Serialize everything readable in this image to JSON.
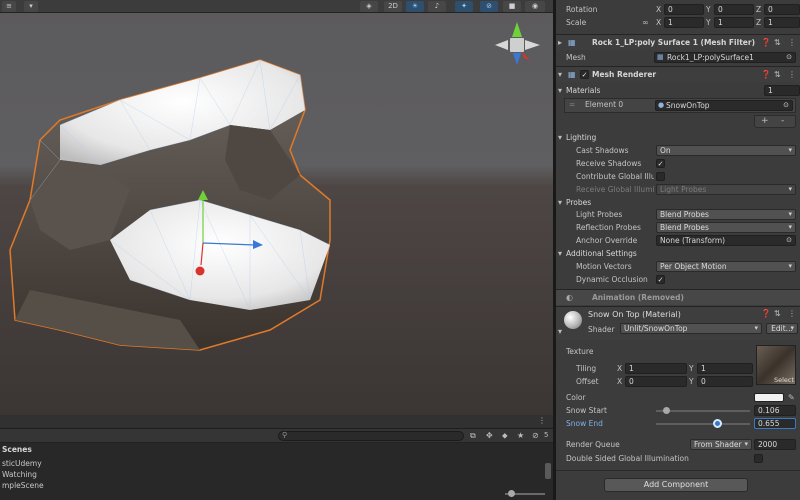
{
  "scene_toolbar": {
    "mode_2d": "2D",
    "left_icon": "menu-icon"
  },
  "bottom_panel": {
    "tab_label": "Scenes",
    "scene_items": [
      "sticUdemy",
      "Watching",
      "mpleScene"
    ],
    "badge_count": "5"
  },
  "inspector": {
    "transform": {
      "rotation_label": "Rotation",
      "rotation": {
        "x": "0",
        "y": "0",
        "z": "0"
      },
      "scale_label": "Scale",
      "scale": {
        "x": "1",
        "y": "1",
        "z": "1"
      }
    },
    "mesh_filter": {
      "title": "Rock 1_LP:poly Surface 1 (Mesh Filter)",
      "mesh_label": "Mesh",
      "mesh_value": "Rock1_LP:polySurface1"
    },
    "mesh_renderer": {
      "title": "Mesh Renderer",
      "materials_label": "Materials",
      "materials_count": "1",
      "element_label": "Element 0",
      "element_value": "SnowOnTop",
      "add_button": "+",
      "remove_button": "-"
    },
    "lighting": {
      "title": "Lighting",
      "cast_shadows_label": "Cast Shadows",
      "cast_shadows_value": "On",
      "receive_shadows_label": "Receive Shadows",
      "contribute_gi_label": "Contribute Global Illu",
      "receive_gi_label": "Receive Global Illumi",
      "receive_gi_value": "Light Probes"
    },
    "probes": {
      "title": "Probes",
      "light_probes_label": "Light Probes",
      "light_probes_value": "Blend Probes",
      "reflection_probes_label": "Reflection Probes",
      "reflection_probes_value": "Blend Probes",
      "anchor_override_label": "Anchor Override",
      "anchor_override_value": "None (Transform)"
    },
    "additional": {
      "title": "Additional Settings",
      "motion_vectors_label": "Motion Vectors",
      "motion_vectors_value": "Per Object Motion",
      "dynamic_occlusion_label": "Dynamic Occlusion"
    },
    "animation": {
      "title": "Animation (Removed)"
    },
    "material": {
      "title": "Snow On Top (Material)",
      "shader_label": "Shader",
      "shader_value": "Unlit/SnowOnTop",
      "edit_button": "Edit...",
      "texture_label": "Texture",
      "tiling_label": "Tiling",
      "tiling": {
        "x": "1",
        "y": "1"
      },
      "offset_label": "Offset",
      "offset": {
        "x": "0",
        "y": "0"
      },
      "select_label": "Select",
      "color_label": "Color",
      "color_value": "#f2f2f2",
      "snow_start_label": "Snow Start",
      "snow_start_value": "0.106",
      "snow_start_fraction": 0.106,
      "snow_end_label": "Snow End",
      "snow_end_value": "0.655",
      "snow_end_fraction": 0.655,
      "render_queue_label": "Render Queue",
      "render_queue_mode": "From Shader",
      "render_queue_value": "2000",
      "double_sided_label": "Double Sided Global Illumination"
    },
    "add_component": "Add Component"
  },
  "axis_labels": {
    "x": "X",
    "y": "Y",
    "z": "Z"
  },
  "colors": {
    "accent": "#3a79c4",
    "selection_outline": "#e07a2a",
    "gizmo_x": "#3a78d8",
    "gizmo_y": "#6fd23a",
    "gizmo_z": "#d8342c"
  }
}
